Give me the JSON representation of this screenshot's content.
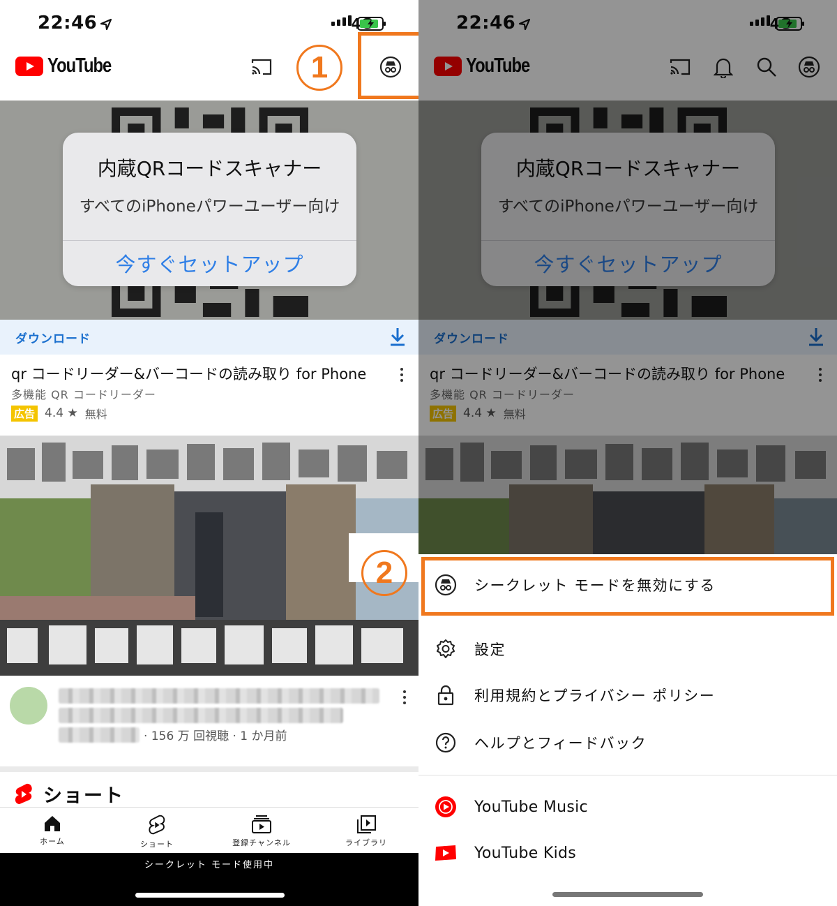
{
  "status_bar": {
    "time": "22:46",
    "network": "4G"
  },
  "header": {
    "logo_text": "YouTube"
  },
  "steps": {
    "one": "1",
    "two": "2"
  },
  "ad": {
    "alert_title": "内蔵QRコードスキャナー",
    "alert_message": "すべてのiPhoneパワーユーザー向け",
    "alert_button": "今すぐセットアップ",
    "download_label": "ダウンロード",
    "title": "qr コードリーダー&バーコードの読み取り for Phone",
    "subtitle": "多機能 QR コードリーダー",
    "badge": "広告",
    "rating": "4.4",
    "price": "無料"
  },
  "video": {
    "meta": "· 156 万 回視聴 · 1 か月前"
  },
  "shorts": {
    "title": "ショート"
  },
  "nav": [
    {
      "label": "ホーム",
      "icon": "home-icon"
    },
    {
      "label": "ショート",
      "icon": "shorts-icon"
    },
    {
      "label": "登録チャンネル",
      "icon": "subscriptions-icon"
    },
    {
      "label": "ライブラリ",
      "icon": "library-icon"
    }
  ],
  "incognito_banner": "シークレット モード使用中",
  "menu": {
    "disable_incognito": "シークレット モードを無効にする",
    "settings": "設定",
    "terms": "利用規約とプライバシー ポリシー",
    "help": "ヘルプとフィードバック",
    "yt_music": "YouTube Music",
    "yt_kids": "YouTube Kids"
  },
  "colors": {
    "brand_red": "#ff0000",
    "highlight_orange": "#f0781e",
    "link_blue": "#2f7fe6",
    "download_blue": "#1a6fce",
    "ad_badge": "#f4c400"
  }
}
